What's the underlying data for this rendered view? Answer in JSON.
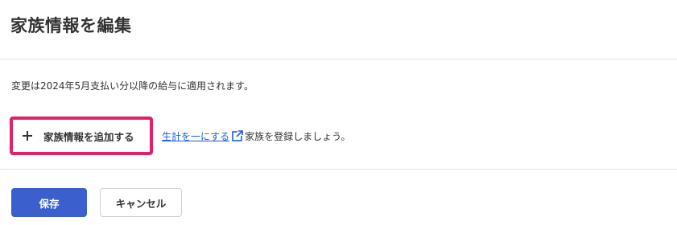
{
  "header": {
    "title": "家族情報を編集"
  },
  "notice": "変更は2024年5月支払い分以降の給与に適用されます。",
  "add_family": {
    "icon": "plus-icon",
    "label": "家族情報を追加する"
  },
  "hint": {
    "link_text": "生計を一にする",
    "link_icon": "external-link-icon",
    "suffix": "家族を登録しましょう。"
  },
  "actions": {
    "save_label": "保存",
    "cancel_label": "キャンセル"
  },
  "colors": {
    "primary": "#3b5fcc",
    "highlight": "#e0206a",
    "link": "#1a5fd1"
  }
}
